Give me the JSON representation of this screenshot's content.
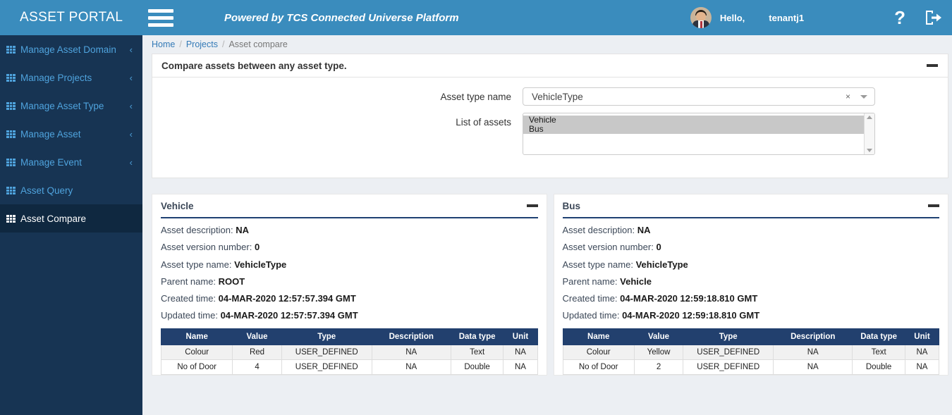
{
  "header": {
    "brand": "ASSET PORTAL",
    "menu_icon": "hamburger-icon",
    "powered_by": "Powered by TCS Connected Universe Platform",
    "hello": "Hello,",
    "username": "tenantj1",
    "help_icon": "?",
    "logout_icon": "logout-icon",
    "bg_color": "#3a8cbd"
  },
  "sidebar": {
    "bg_color": "#173453",
    "active_bg_color": "#0f2840",
    "link_color": "#4fa3dd",
    "items": [
      {
        "label": "Manage Asset Domain",
        "chevron": "‹",
        "active": false
      },
      {
        "label": "Manage Projects",
        "chevron": "‹",
        "active": false
      },
      {
        "label": "Manage Asset Type",
        "chevron": "‹",
        "active": false
      },
      {
        "label": "Manage Asset",
        "chevron": "‹",
        "active": false
      },
      {
        "label": "Manage Event",
        "chevron": "‹",
        "active": false
      },
      {
        "label": "Asset Query",
        "chevron": "",
        "active": false
      },
      {
        "label": "Asset Compare",
        "chevron": "",
        "active": true
      }
    ]
  },
  "breadcrumb": {
    "home": "Home",
    "projects": "Projects",
    "current": "Asset compare",
    "separator": "/"
  },
  "compare_card": {
    "title": "Compare assets between any asset type.",
    "collapse_icon": "minus-icon",
    "asset_type_label": "Asset type name",
    "asset_type_value": "VehicleType",
    "asset_type_clear": "×",
    "list_label": "List of assets",
    "list_items": [
      {
        "label": "Vehicle",
        "selected": true
      },
      {
        "label": "Bus",
        "selected": true
      }
    ]
  },
  "panels": [
    {
      "title": "Vehicle",
      "collapse_icon": "minus-icon",
      "details": [
        {
          "label": "Asset description:",
          "value": "NA"
        },
        {
          "label": "Asset version number:",
          "value": "0"
        },
        {
          "label": "Asset type name:",
          "value": "VehicleType"
        },
        {
          "label": "Parent name:",
          "value": "ROOT"
        },
        {
          "label": "Created time:",
          "value": "04-MAR-2020 12:57:57.394 GMT"
        },
        {
          "label": "Updated time:",
          "value": "04-MAR-2020 12:57:57.394 GMT"
        }
      ],
      "table": {
        "columns": [
          "Name",
          "Value",
          "Type",
          "Description",
          "Data type",
          "Unit"
        ],
        "rows": [
          [
            "Colour",
            "Red",
            "USER_DEFINED",
            "NA",
            "Text",
            "NA"
          ],
          [
            "No of Door",
            "4",
            "USER_DEFINED",
            "NA",
            "Double",
            "NA"
          ]
        ]
      }
    },
    {
      "title": "Bus",
      "collapse_icon": "minus-icon",
      "details": [
        {
          "label": "Asset description:",
          "value": "NA"
        },
        {
          "label": "Asset version number:",
          "value": "0"
        },
        {
          "label": "Asset type name:",
          "value": "VehicleType"
        },
        {
          "label": "Parent name:",
          "value": "Vehicle"
        },
        {
          "label": "Created time:",
          "value": "04-MAR-2020 12:59:18.810 GMT"
        },
        {
          "label": "Updated time:",
          "value": "04-MAR-2020 12:59:18.810 GMT"
        }
      ],
      "table": {
        "columns": [
          "Name",
          "Value",
          "Type",
          "Description",
          "Data type",
          "Unit"
        ],
        "rows": [
          [
            "Colour",
            "Yellow",
            "USER_DEFINED",
            "NA",
            "Text",
            "NA"
          ],
          [
            "No of Door",
            "2",
            "USER_DEFINED",
            "NA",
            "Double",
            "NA"
          ]
        ]
      }
    }
  ]
}
